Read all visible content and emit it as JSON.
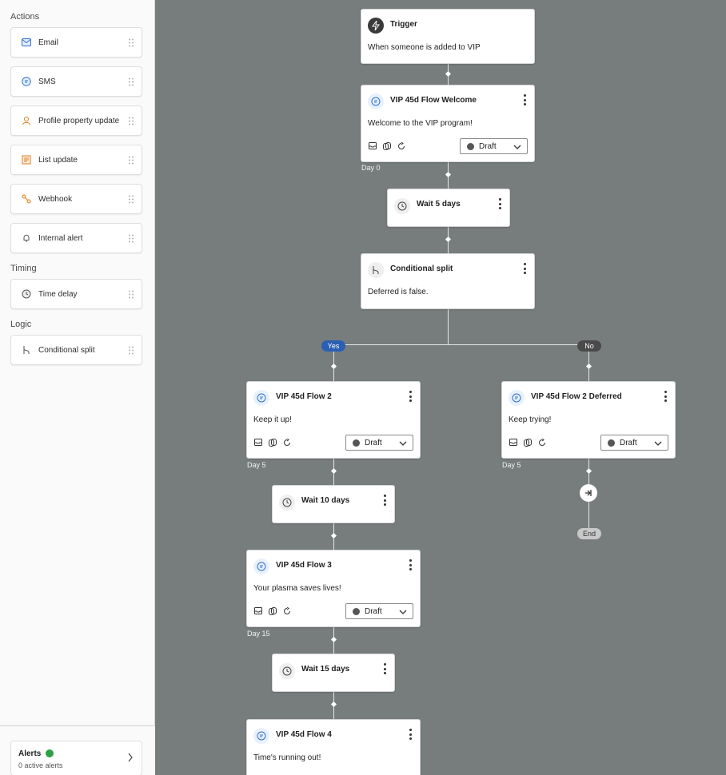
{
  "sidebar": {
    "sections": {
      "actions": "Actions",
      "timing": "Timing",
      "logic": "Logic"
    },
    "items": [
      {
        "label": "Email",
        "icon": "email-icon"
      },
      {
        "label": "SMS",
        "icon": "sms-icon"
      },
      {
        "label": "Profile property update",
        "icon": "profile-icon"
      },
      {
        "label": "List update",
        "icon": "list-icon"
      },
      {
        "label": "Webhook",
        "icon": "webhook-icon"
      },
      {
        "label": "Internal alert",
        "icon": "bell-icon"
      },
      {
        "label": "Time delay",
        "icon": "clock-icon"
      },
      {
        "label": "Conditional split",
        "icon": "split-icon"
      }
    ],
    "alerts": {
      "title": "Alerts",
      "subtitle": "0 active alerts"
    }
  },
  "flow": {
    "trigger": {
      "title": "Trigger",
      "desc": "When someone is added to VIP"
    },
    "welcome": {
      "title": "VIP 45d Flow Welcome",
      "desc": "Welcome to the VIP program!",
      "status": "Draft",
      "day": "Day 0"
    },
    "wait1": {
      "title": "Wait 5 days"
    },
    "split": {
      "title": "Conditional split",
      "desc": "Deferred is false.",
      "yes": "Yes",
      "no": "No"
    },
    "flow2": {
      "title": "VIP 45d Flow 2",
      "desc": "Keep it up!",
      "status": "Draft",
      "day": "Day 5"
    },
    "flow2d": {
      "title": "VIP 45d Flow 2 Deferred",
      "desc": "Keep trying!",
      "status": "Draft",
      "day": "Day 5"
    },
    "end": "End",
    "wait2": {
      "title": "Wait 10 days"
    },
    "flow3": {
      "title": "VIP 45d Flow 3",
      "desc": "Your plasma saves lives!",
      "status": "Draft",
      "day": "Day 15"
    },
    "wait3": {
      "title": "Wait 15 days"
    },
    "flow4": {
      "title": "VIP 45d Flow 4",
      "desc": "Time's running out!"
    }
  },
  "colors": {
    "canvas": "#777d7d",
    "yes_pill": "#2b5fb3",
    "no_pill": "#4a4a4a",
    "icon_bg": "#e8f1fb",
    "accent": "#2f6fcf"
  }
}
